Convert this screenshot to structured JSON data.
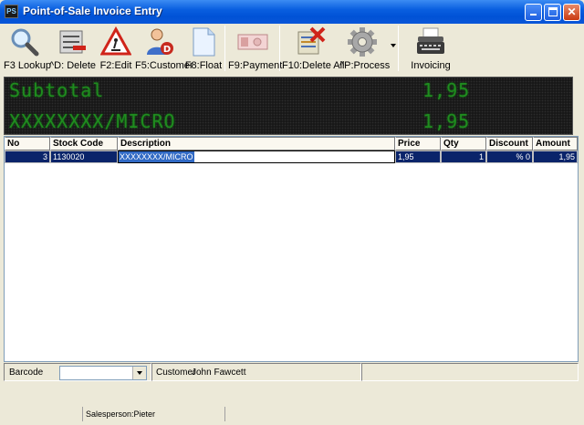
{
  "window": {
    "title": "Point-of-Sale Invoice Entry",
    "app_icon_text": "PS"
  },
  "toolbar": {
    "buttons": [
      {
        "label": "F3 Lookup",
        "icon": "magnifier-icon"
      },
      {
        "label": "^D: Delete",
        "icon": "delete-line-icon"
      },
      {
        "label": "F2:Edit",
        "icon": "roadwork-sign-icon"
      },
      {
        "label": "F5:Customer",
        "icon": "customer-icon"
      },
      {
        "label": "F8:Float",
        "icon": "document-icon"
      },
      {
        "label": "F9:Payment",
        "icon": "banknote-icon"
      },
      {
        "label": "F10:Delete All",
        "icon": "delete-all-icon"
      },
      {
        "label": "^P:Process",
        "icon": "gear-icon"
      },
      {
        "label": "Invoicing",
        "icon": "typewriter-icon"
      }
    ]
  },
  "display": {
    "subtotal_label": "Subtotal",
    "subtotal_value": "1,95",
    "item_label": "XXXXXXXX/MICRO",
    "item_value": "1,95"
  },
  "grid": {
    "columns": [
      "No",
      "Stock Code",
      "Description",
      "Price",
      "Qty",
      "Discount",
      "Amount"
    ],
    "rows": [
      {
        "no": "3",
        "stock_code": "1130020",
        "description": "XXXXXXXX/MICRO",
        "price": "1,95",
        "qty": "1",
        "discount": "% 0",
        "amount": "1,95"
      }
    ]
  },
  "bottom": {
    "barcode_label": "Barcode",
    "barcode_value": "",
    "customer_label": "Customer",
    "customer_value": "John Fawcett"
  },
  "status": {
    "salesperson": "Salesperson:Pieter"
  },
  "colors": {
    "title_blue": "#0a5fe0",
    "selection_navy": "#0a246a",
    "led_green": "#1f8c1f"
  }
}
